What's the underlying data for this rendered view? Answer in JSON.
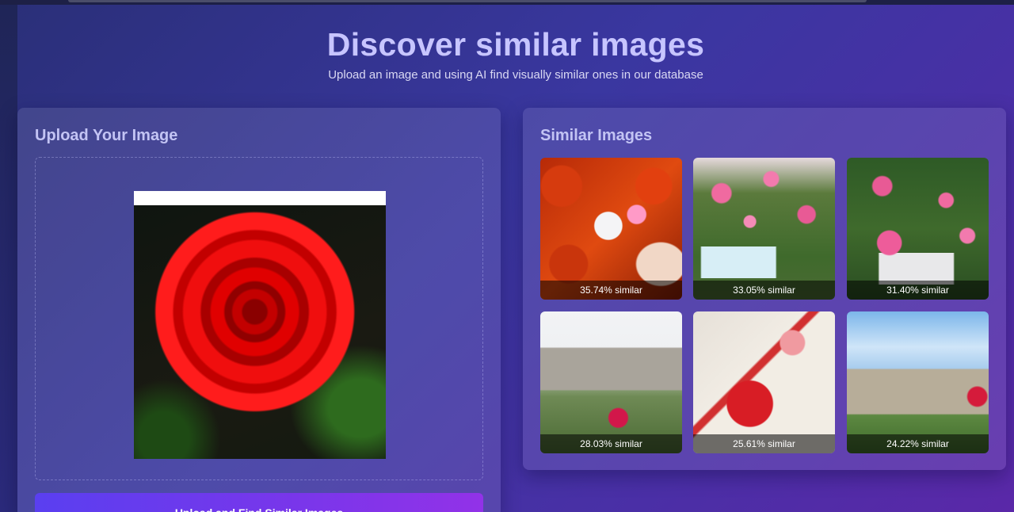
{
  "header": {
    "title": "Discover similar images",
    "subtitle": "Upload an image and using AI find visually similar ones in our database"
  },
  "upload_panel": {
    "title": "Upload Your Image",
    "button_label": "Upload and Find Similar Images"
  },
  "results_panel": {
    "title": "Similar Images",
    "items": [
      {
        "caption": "35.74% similar"
      },
      {
        "caption": "33.05% similar"
      },
      {
        "caption": "31.40% similar"
      },
      {
        "caption": "28.03% similar"
      },
      {
        "caption": "25.61% similar"
      },
      {
        "caption": "24.22% similar"
      }
    ]
  },
  "colors": {
    "title": "#c7c5ff",
    "button_start": "#5a3ff0",
    "button_end": "#9232e8"
  }
}
